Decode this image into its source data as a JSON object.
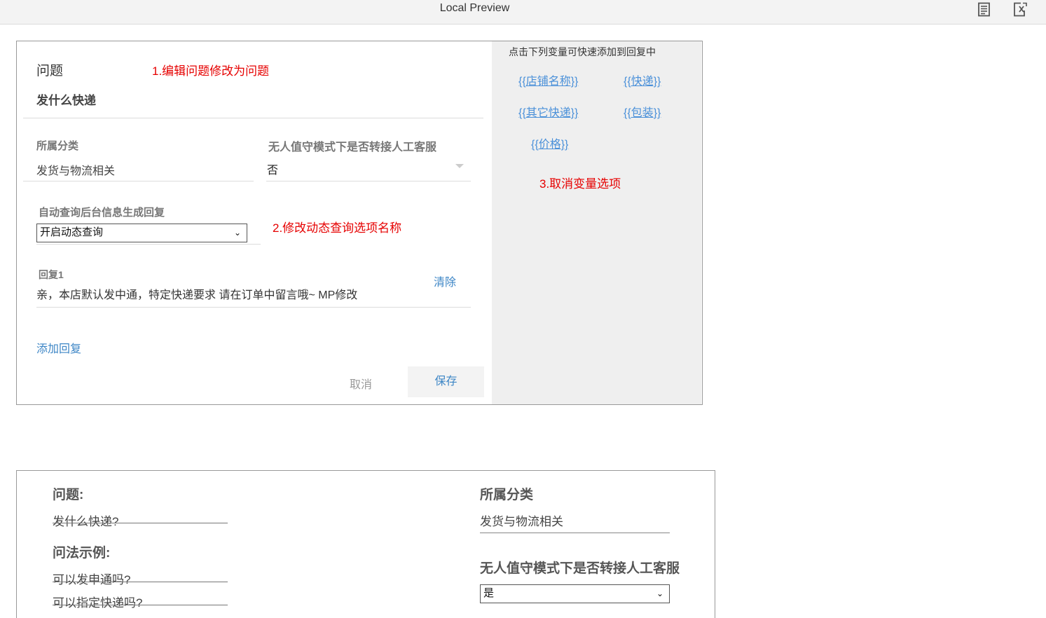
{
  "window": {
    "title": "Local Preview",
    "icons": [
      "document-icon",
      "export-icon"
    ]
  },
  "editor": {
    "question_label": "问题",
    "question_value": "发什么快递",
    "annotation_1": "1.编辑问题修改为问题",
    "category_label": "所属分类",
    "category_value": "发货与物流相关",
    "unattended_label": "无人值守模式下是否转接人工客服",
    "unattended_value": "否",
    "auto_query_label": "自动查询后台信息生成回复",
    "auto_query_value": "开启动态查询",
    "annotation_2": "2.修改动态查询选项名称",
    "reply_label": "回复1",
    "reply_value": "亲，本店默认发中通，特定快递要求 请在订单中留言哦~ MP修改",
    "clear_label": "清除",
    "add_reply_label": "添加回复",
    "cancel_label": "取消",
    "save_label": "保存"
  },
  "variables": {
    "hint": "点击下列变量可快速添加到回复中",
    "items": [
      "{{店铺名称}}",
      "{{快递}}",
      "{{其它快递}}",
      "{{包装}}",
      "{{价格}}"
    ],
    "annotation_3": "3.取消变量选项"
  },
  "form2": {
    "question_label": "问题:",
    "question_value": "发什么快递?",
    "examples_label": "问法示例:",
    "examples": [
      "可以发申通吗?",
      "可以指定快递吗?"
    ],
    "category_label": "所属分类",
    "category_value": "发货与物流相关",
    "unattended_label": "无人值守模式下是否转接人工客服",
    "unattended_value": "是"
  }
}
